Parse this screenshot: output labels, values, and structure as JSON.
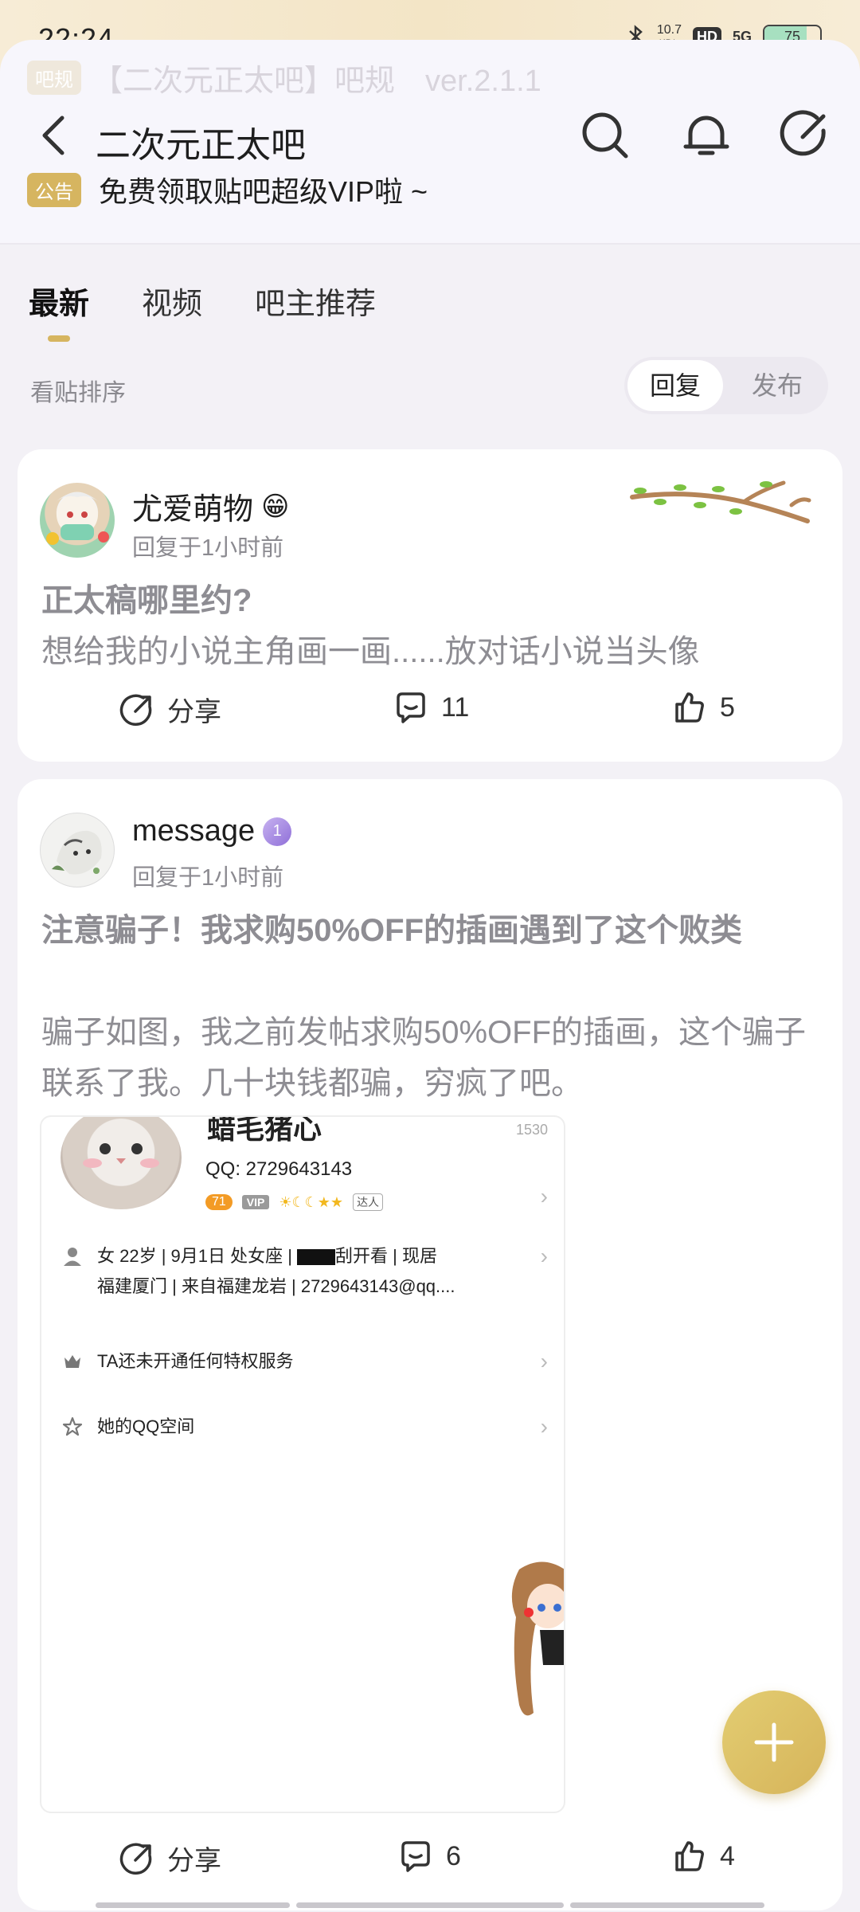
{
  "status_bar": {
    "time": "22:24",
    "net_speed": "10.7",
    "net_unit": "KB/s",
    "hd": "HD",
    "signal": "5G",
    "battery": "75"
  },
  "header": {
    "rule_tag": "吧规",
    "rule_text": "【二次元正太吧】吧规　ver.2.1.1",
    "title": "二次元正太吧",
    "notice_tag": "公告",
    "notice_text": "免费领取贴吧超级VIP啦 ~",
    "icons": [
      "back-icon",
      "search-icon",
      "bell-icon",
      "compose-icon"
    ]
  },
  "tabs": [
    {
      "label": "最新",
      "active": true
    },
    {
      "label": "视频",
      "active": false
    },
    {
      "label": "吧主推荐",
      "active": false
    }
  ],
  "sort": {
    "label": "看贴排序",
    "options": [
      "回复",
      "发布"
    ],
    "selected": "回复"
  },
  "posts": [
    {
      "author": "尤爱萌物",
      "author_emoji": "😁",
      "time": "回复于1小时前",
      "title": "正太稿哪里约?",
      "body": "想给我的小说主角画一画......放对话小说当头像",
      "share_label": "分享",
      "comments": "11",
      "likes": "5"
    },
    {
      "author": "message",
      "badge": "1",
      "time": "回复于1小时前",
      "title": "注意骗子！我求购50%OFF的插画遇到了这个败类",
      "body": "骗子如图，我之前发帖求购50%OFF的插画，这个骗子联系了我。几十块钱都骗，穷疯了吧。",
      "share_label": "分享",
      "comments": "6",
      "likes": "4",
      "image": {
        "name": "蜡毛猪心",
        "corner_number": "1530",
        "qq": "QQ:  2729643143",
        "level": "71",
        "vip": "VIP",
        "medal": "达人",
        "info_line1_a": "女  22岁  |  9月1日  处女座  |  ",
        "info_line1_b": "刮开看  |  现居",
        "info_line2": "福建厦门  |  来自福建龙岩  |  2729643143@qq....",
        "service": "TA还未开通任何特权服务",
        "qzone": "她的QQ空间"
      }
    }
  ],
  "fab": {
    "icon": "plus-icon"
  },
  "colors": {
    "accent": "#d6b560",
    "background": "#f3f1f6",
    "muted_text": "#8e8d93"
  }
}
